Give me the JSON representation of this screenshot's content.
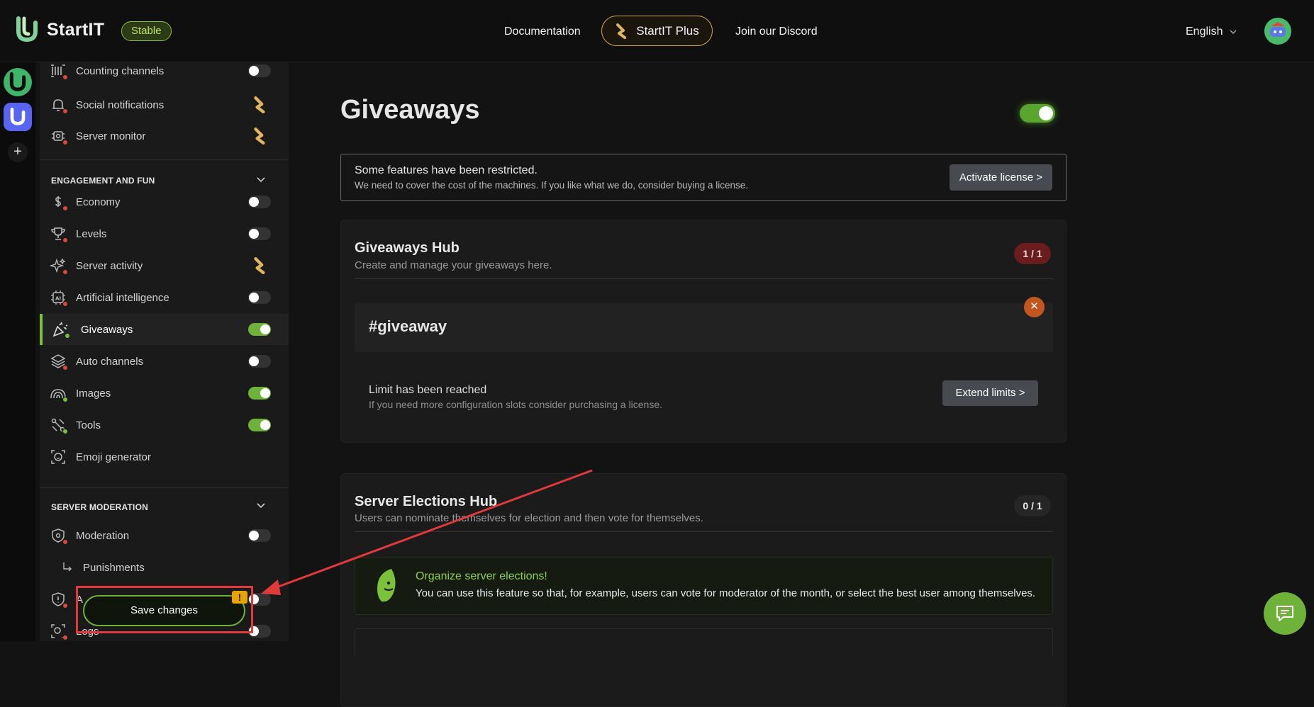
{
  "header": {
    "app_name": "StartIT",
    "channel_badge": "Stable",
    "nav": {
      "documentation": "Documentation",
      "plus": "StartIT Plus",
      "discord": "Join our Discord"
    },
    "language": "English"
  },
  "sidebar": {
    "top_items": [
      {
        "label": "Counting channels",
        "state": "off"
      },
      {
        "label": "Social notifications",
        "state": "plus"
      },
      {
        "label": "Server monitor",
        "state": "plus"
      }
    ],
    "engagement": {
      "heading": "ENGAGEMENT AND FUN",
      "items": [
        {
          "label": "Economy",
          "state": "off"
        },
        {
          "label": "Levels",
          "state": "off"
        },
        {
          "label": "Server activity",
          "state": "plus"
        },
        {
          "label": "Artificial intelligence",
          "state": "off"
        },
        {
          "label": "Giveaways",
          "state": "on"
        },
        {
          "label": "Auto channels",
          "state": "off"
        },
        {
          "label": "Images",
          "state": "on"
        },
        {
          "label": "Tools",
          "state": "on"
        },
        {
          "label": "Emoji generator",
          "state": "none"
        }
      ]
    },
    "moderation": {
      "heading": "SERVER MODERATION",
      "items": [
        {
          "label": "Moderation",
          "state": "off"
        },
        {
          "label": "Punishments",
          "state": "none"
        },
        {
          "label": "A",
          "state": "off"
        },
        {
          "label": "Logs",
          "state": "off"
        }
      ]
    },
    "save_label": "Save changes",
    "warning_mark": "!"
  },
  "main": {
    "title": "Giveaways",
    "enabled": true,
    "notice": {
      "title": "Some features have been restricted.",
      "text": "We need to cover the cost of the machines. If you like what we do, consider buying a license.",
      "button": "Activate license >"
    },
    "giveaways_hub": {
      "title": "Giveaways Hub",
      "subtitle": "Create and manage your giveaways here.",
      "count": "1 / 1",
      "channel": "#giveaway",
      "remove": "✕",
      "limit_title": "Limit has been reached",
      "limit_text": "If you need more configuration slots consider purchasing a license.",
      "limit_button": "Extend limits >"
    },
    "elections_hub": {
      "title": "Server Elections Hub",
      "subtitle": "Users can nominate themselves for election and then vote for themselves.",
      "count": "0 / 1",
      "promo_title": "Organize server elections!",
      "promo_text": "You can use this feature so that, for example, users can vote for moderator of the month, or select the best user among themselves."
    }
  },
  "colors": {
    "accent_green": "#6fb23a",
    "plus_gold": "#d1a655",
    "danger_red": "#e03a3a"
  }
}
